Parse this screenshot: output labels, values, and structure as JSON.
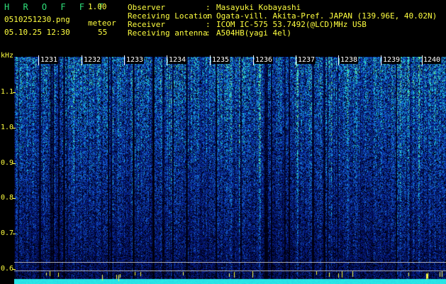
{
  "header": {
    "app_name": "H R O F F T",
    "version": "1.00",
    "filename": "0510251230.png",
    "datetime": "05.10.25 12:30",
    "meteor_label": "meteor",
    "meteor_count": "55"
  },
  "info": {
    "rows": [
      {
        "label": "Observer",
        "value": "Masayuki Kobayashi"
      },
      {
        "label": "Receiving Location",
        "value": "Ogata-vill. Akita-Pref. JAPAN (139.96E, 40.02N)"
      },
      {
        "label": "Receiver",
        "value": "ICOM IC-575 53.7492(@LCD)MHz USB"
      },
      {
        "label": "Receiving antenna",
        "value": "A504HB(yagi 4el)"
      }
    ]
  },
  "spectrogram": {
    "y_unit": "kHz",
    "y_ticks": [
      "1.1",
      "1.0",
      "0.9",
      "0.8",
      "0.7",
      "0.6"
    ],
    "time_ticks": [
      "1231",
      "1232",
      "1233",
      "1234",
      "1235",
      "1236",
      "1237",
      "1238",
      "1239",
      "1240"
    ],
    "colors": {
      "low": "#000010",
      "mid": "#1f4fd8",
      "high": "#3ce0a0",
      "peak": "#ffff40"
    }
  }
}
